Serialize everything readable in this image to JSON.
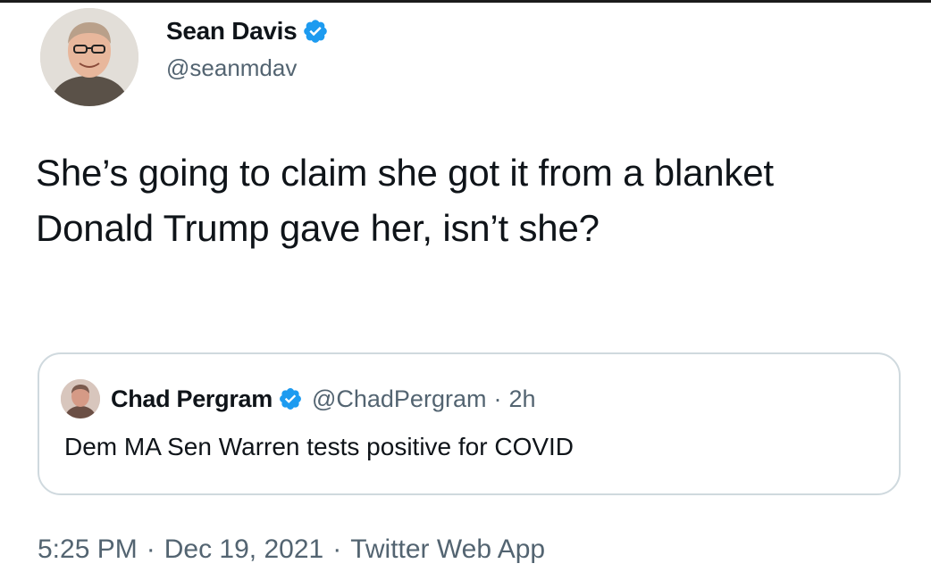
{
  "tweet": {
    "author": {
      "display_name": "Sean Davis",
      "handle": "@seanmdav",
      "verified": true,
      "avatar_icon": "person-avatar-icon"
    },
    "text": "She’s going to claim she got it from a blanket Donald Trump gave her, isn’t she?",
    "quoted_tweet": {
      "author": {
        "display_name": "Chad Pergram",
        "handle": "@ChadPergram",
        "verified": true,
        "avatar_icon": "person-avatar-icon"
      },
      "separator": "·",
      "time_ago": "2h",
      "text": "Dem MA Sen Warren tests positive for COVID"
    },
    "meta": {
      "time": "5:25 PM",
      "date": "Dec 19, 2021",
      "source": "Twitter Web App",
      "separator": "·"
    }
  },
  "colors": {
    "verified_blue": "#1d9bf0",
    "text_primary": "#0f1419",
    "text_secondary": "#536471",
    "border": "#cfd9de"
  }
}
